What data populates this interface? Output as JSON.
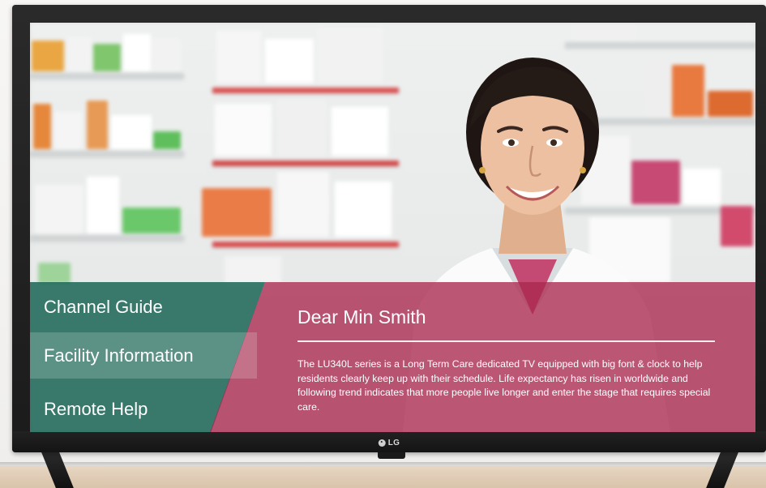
{
  "brand": {
    "logo_text": "LG"
  },
  "menu": {
    "items": [
      {
        "label": "Channel Guide"
      },
      {
        "label": "Facility Information"
      },
      {
        "label": "Remote Help"
      }
    ],
    "selected_index": 1
  },
  "message": {
    "title": "Dear Min Smith",
    "body": "The LU340L series is a Long Term Care dedicated TV equipped with big font & clock to help residents clearly keep up with their schedule. Life expectancy has risen in worldwide and following trend indicates that more people live longer and enter the stage that requires special care."
  },
  "colors": {
    "menu_panel": "#126050",
    "message_panel": "#aa2850",
    "tv_bezel": "#1b1b1b"
  }
}
